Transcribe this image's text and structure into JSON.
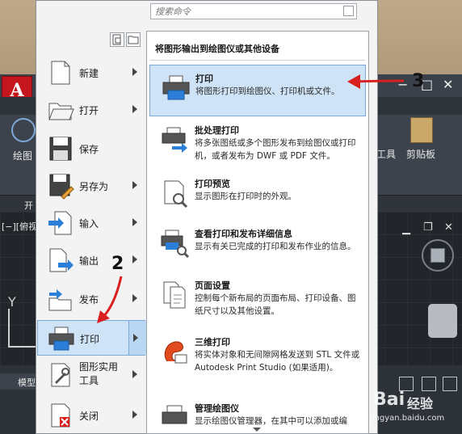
{
  "background_app": {
    "app_logo": "A",
    "ribbon_labels": {
      "draw": "绘图",
      "tools": "工具",
      "clipboard": "剪贴板",
      "start_tab": "开"
    },
    "viewport_label": "[−][俯视",
    "layout_tab": "模型",
    "axis_label": "Y",
    "window_controls": [
      "−",
      "□",
      "✕"
    ]
  },
  "search": {
    "placeholder": "搜索命令"
  },
  "left_menu": {
    "items": [
      {
        "label": "新建",
        "icon": "new-document-icon",
        "has_submenu": true
      },
      {
        "label": "打开",
        "icon": "open-folder-icon",
        "has_submenu": true
      },
      {
        "label": "保存",
        "icon": "save-disk-icon",
        "has_submenu": false
      },
      {
        "label": "另存为",
        "icon": "save-as-icon",
        "has_submenu": true
      },
      {
        "label": "输入",
        "icon": "import-icon",
        "has_submenu": true
      },
      {
        "label": "输出",
        "icon": "export-icon",
        "has_submenu": true
      },
      {
        "label": "发布",
        "icon": "publish-icon",
        "has_submenu": true
      },
      {
        "label": "打印",
        "icon": "printer-icon",
        "has_submenu": true,
        "active": true
      },
      {
        "label": "图形实用工具",
        "label_lines": [
          "图形实用",
          "工具"
        ],
        "icon": "drawing-utilities-icon",
        "has_submenu": true
      },
      {
        "label": "关闭",
        "icon": "close-document-icon",
        "has_submenu": true
      }
    ]
  },
  "print_panel": {
    "title": "将图形输出到绘图仪或其他设备",
    "items": [
      {
        "title": "打印",
        "desc": "将图形打印到绘图仪、打印机或文件。",
        "icon": "printer-icon",
        "active": true
      },
      {
        "title": "批处理打印",
        "desc": "将多张图纸或多个图形发布到绘图仪或打印机，或者发布为 DWF 或 PDF 文件。",
        "icon": "batch-plot-icon"
      },
      {
        "title": "打印预览",
        "desc": "显示图形在打印时的外观。",
        "icon": "plot-preview-icon"
      },
      {
        "title": "查看打印和发布详细信息",
        "desc": "显示有关已完成的打印和发布作业的信息。",
        "icon": "plot-details-icon"
      },
      {
        "title": "页面设置",
        "desc": "控制每个新布局的页面布局、打印设备、图纸尺寸以及其他设置。",
        "icon": "page-setup-icon"
      },
      {
        "title": "三维打印",
        "desc": "将实体对象和无间隙网格发送到 STL 文件或 Autodesk Print Studio (如果适用)。",
        "icon": "3d-print-icon"
      },
      {
        "title": "管理绘图仪",
        "desc": "显示绘图仪管理器，在其中可以添加或编",
        "icon": "plotter-manager-icon"
      }
    ]
  },
  "annotations": {
    "step2": "2",
    "step3": "3",
    "accent_red": "#d9201f"
  },
  "watermark": {
    "brand": "Bai",
    "suffix": "经验",
    "url": "jingyan.baidu.com"
  },
  "colors": {
    "highlight": "#cfe3f7",
    "highlight_border": "#7da9d8",
    "autocad_red": "#c4161c"
  }
}
